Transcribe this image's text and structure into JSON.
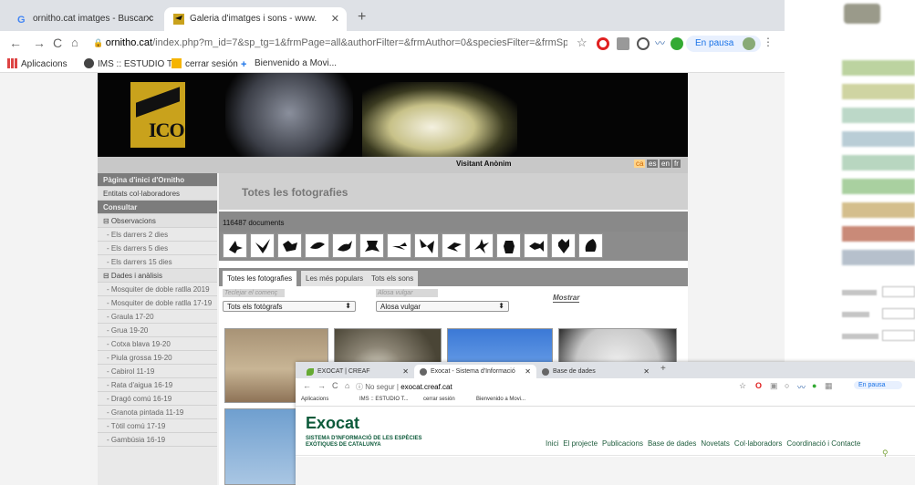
{
  "browser": {
    "tabs": [
      {
        "label": "ornitho.cat imatges - Buscar c",
        "active": false
      },
      {
        "label": "Galeria d'imatges i sons - www.",
        "active": true
      }
    ],
    "url_host": "ornitho.cat",
    "url_path": "/index.php?m_id=7&sp_tg=1&frmPage=all&authorFilter=&frmAuthor=0&speciesFilter=&frmSpe...",
    "pause_label": "En pausa",
    "bookmarks": [
      "Aplicacions",
      "IMS :: ESTUDIO T...",
      "cerrar sesión",
      "Bienvenido a Movi..."
    ]
  },
  "site": {
    "logo_text": "ICO",
    "user_label": "Visitant Anònim",
    "languages": [
      {
        "code": "ca",
        "selected": true
      },
      {
        "code": "es",
        "selected": false
      },
      {
        "code": "en",
        "selected": false
      },
      {
        "code": "fr",
        "selected": false
      }
    ],
    "sidebar": [
      {
        "label": "Pàgina d'inici d'Ornitho",
        "kind": "hdr"
      },
      {
        "label": "Entitats col·laboradores",
        "kind": "top"
      },
      {
        "label": "Consultar",
        "kind": "hdr"
      },
      {
        "label": "⊟ Observacions",
        "kind": "top"
      },
      {
        "label": "- Els darrers 2 dies",
        "kind": "sub"
      },
      {
        "label": "- Els darrers 5 dies",
        "kind": "sub"
      },
      {
        "label": "- Els darrers 15 dies",
        "kind": "sub"
      },
      {
        "label": "⊟ Dades i anàlisis",
        "kind": "top"
      },
      {
        "label": "- Mosquiter de doble ratlla 2019",
        "kind": "sub"
      },
      {
        "label": "- Mosquiter de doble ratlla 17-19",
        "kind": "sub"
      },
      {
        "label": "- Graula 17-20",
        "kind": "sub"
      },
      {
        "label": "- Grua 19-20",
        "kind": "sub"
      },
      {
        "label": "- Cotxa blava 19-20",
        "kind": "sub"
      },
      {
        "label": "- Piula grossa 19-20",
        "kind": "sub"
      },
      {
        "label": "- Cabirol 11-19",
        "kind": "sub"
      },
      {
        "label": "- Rata d'aigua 16-19",
        "kind": "sub"
      },
      {
        "label": "- Dragó comú 16-19",
        "kind": "sub"
      },
      {
        "label": "- Granota pintada 11-19",
        "kind": "sub"
      },
      {
        "label": "- Tòtil comú 17-19",
        "kind": "sub"
      },
      {
        "label": "- Gambúsia 16-19",
        "kind": "sub"
      }
    ],
    "main": {
      "title": "Totes les fotografies",
      "count": "116487 documents",
      "species_groups": [
        "bird-icon",
        "bat-icon",
        "mammal-icon",
        "dolphin-icon",
        "reptile-icon",
        "frog-icon",
        "dragonfly-icon",
        "butterfly-icon",
        "grasshopper-icon",
        "mantis-icon",
        "beetle-icon",
        "fish-icon",
        "crab-icon",
        "shell-icon"
      ],
      "tabs": [
        {
          "label": "Totes les fotografies",
          "active": true
        },
        {
          "label": "Les més populars",
          "active": false
        },
        {
          "label": "Tots els sons",
          "active": false
        }
      ],
      "author_placeholder": "Teclejar el començ",
      "author_value": "Tots els fotògrafs",
      "species_placeholder": "Alosa vulgar",
      "species_value": "Alosa vulgar",
      "show_button": "Mostrar"
    }
  },
  "second_window": {
    "tabs": [
      {
        "label": "EXOCAT | CREAF",
        "active": false
      },
      {
        "label": "Exocat - Sistema d'Informació",
        "active": true
      },
      {
        "label": "Base de dades",
        "active": false
      }
    ],
    "url_prefix": "No segur",
    "url_host": "exocat.creaf.cat",
    "pause_label": "En pausa",
    "bookmarks": [
      "Aplicacions",
      "IMS :: ESTUDIO T...",
      "cerrar sesión",
      "Bienvenido a Movi..."
    ],
    "brand": "Exocat",
    "brand_sub_1": "SISTEMA D'INFORMACIÓ DE LES ESPÈCIES",
    "brand_sub_2": "EXÒTIQUES DE CATALUNYA",
    "menu": [
      "Inici",
      "El projecte",
      "Publicacions",
      "Base de dades",
      "Novetats",
      "Col·laboradors",
      "Coordinació i Contacte"
    ]
  },
  "colors": {
    "exocat_green": "#0c5a3a",
    "ornitho_gold": "#c9a21c",
    "chrome_tab": "#dee1e6"
  }
}
